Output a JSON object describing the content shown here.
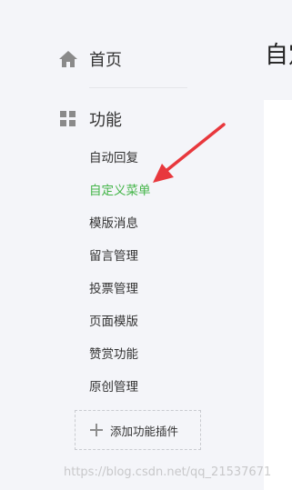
{
  "sidebar": {
    "home_label": "首页",
    "section_label": "功能",
    "items": [
      {
        "label": "自动回复"
      },
      {
        "label": "自定义菜单"
      },
      {
        "label": "模版消息"
      },
      {
        "label": "留言管理"
      },
      {
        "label": "投票管理"
      },
      {
        "label": "页面模版"
      },
      {
        "label": "赞赏功能"
      },
      {
        "label": "原创管理"
      }
    ],
    "active_index": 1,
    "add_plugin_label": "添加功能插件"
  },
  "main": {
    "title_partial": "自定"
  },
  "watermark": "https://blog.csdn.net/qq_21537671",
  "colors": {
    "active": "#44b549",
    "arrow": "#e8383d",
    "text": "#333333",
    "background": "#f4f5f9"
  },
  "icons": {
    "home": "home-icon",
    "section": "grid-icon",
    "add": "plus-icon"
  }
}
